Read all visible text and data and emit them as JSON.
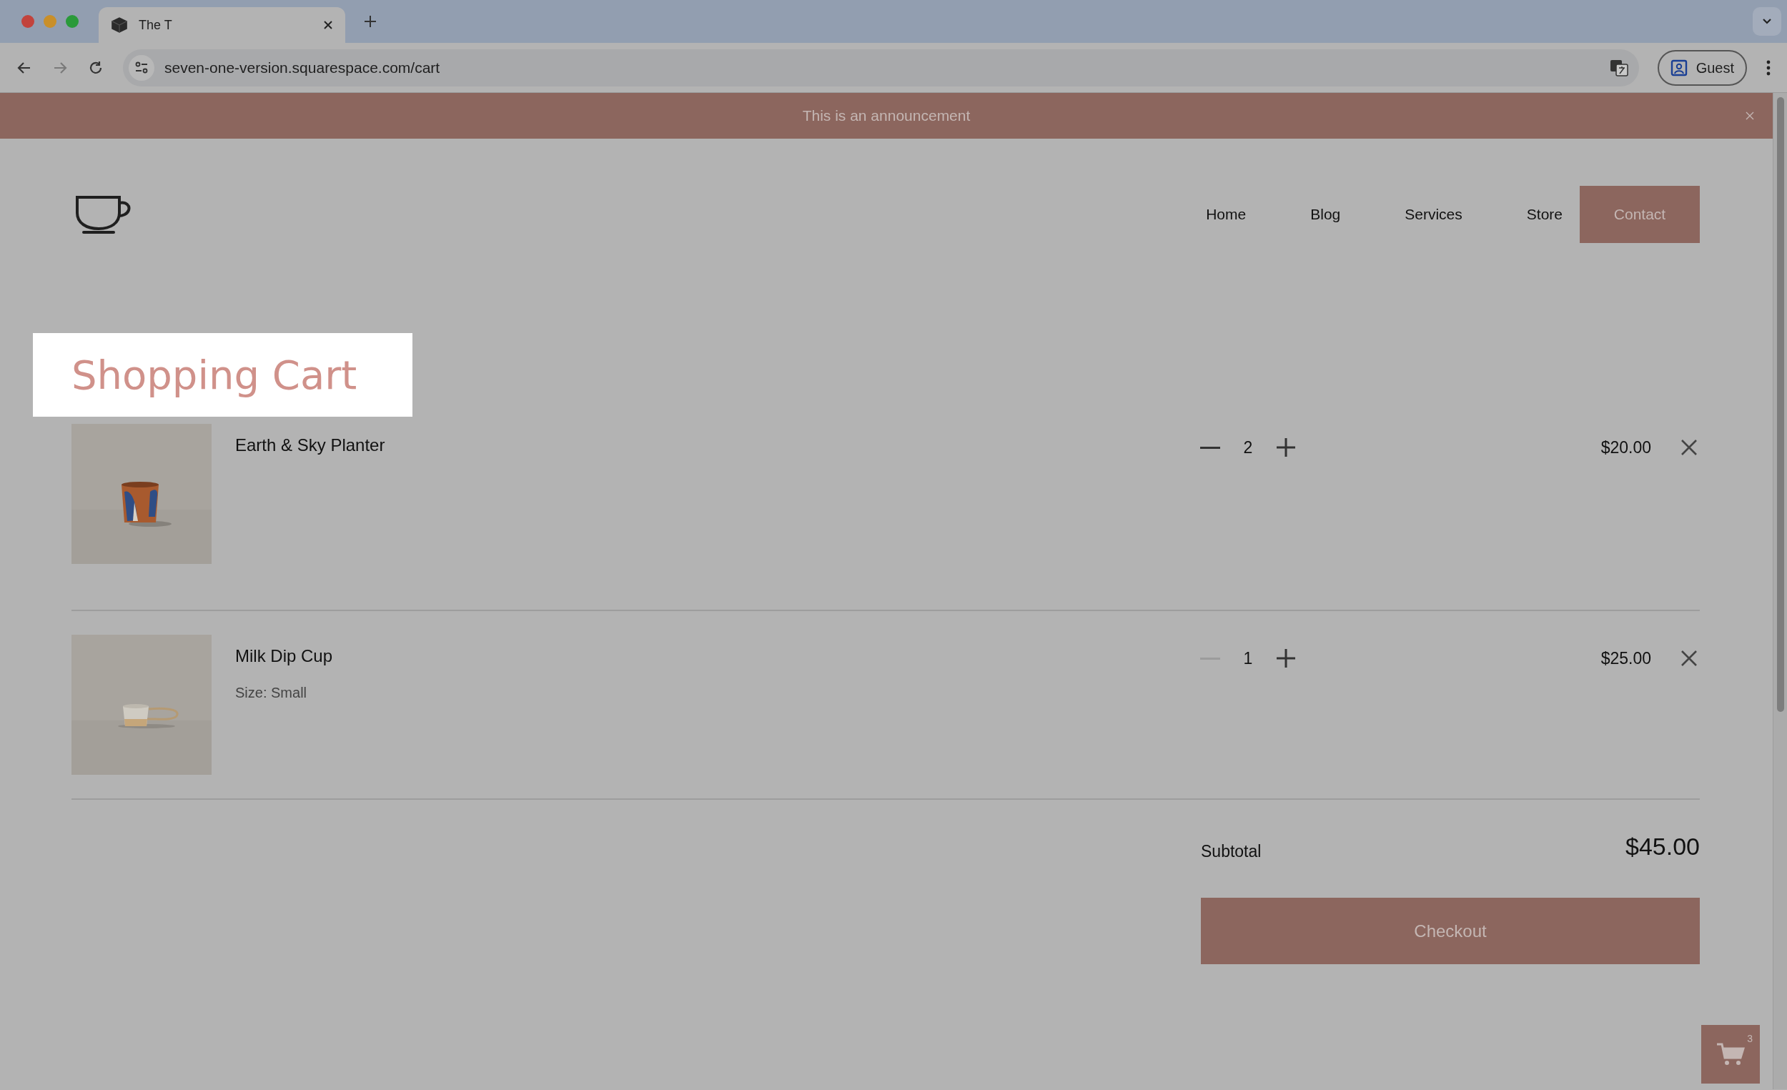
{
  "browser": {
    "tab_title": "The T",
    "url": "seven-one-version.squarespace.com/cart",
    "profile": "Guest"
  },
  "announcement": {
    "text": "This is an announcement"
  },
  "nav": {
    "items": [
      {
        "label": "Home",
        "kind": "link"
      },
      {
        "label": "Blog",
        "kind": "link"
      },
      {
        "label": "Services",
        "kind": "link"
      },
      {
        "label": "Store",
        "kind": "link"
      },
      {
        "label": "Contact",
        "kind": "button"
      }
    ]
  },
  "cart": {
    "title": "Shopping Cart",
    "items": [
      {
        "name": "Earth & Sky Planter",
        "quantity": "2",
        "price": "$20.00",
        "decrement_disabled": false
      },
      {
        "name": "Milk Dip Cup",
        "variant": "Size: Small",
        "quantity": "1",
        "price": "$25.00",
        "decrement_disabled": true
      }
    ],
    "subtotal_label": "Subtotal",
    "subtotal": "$45.00",
    "checkout": "Checkout"
  },
  "cart_badge": {
    "count": "3"
  }
}
